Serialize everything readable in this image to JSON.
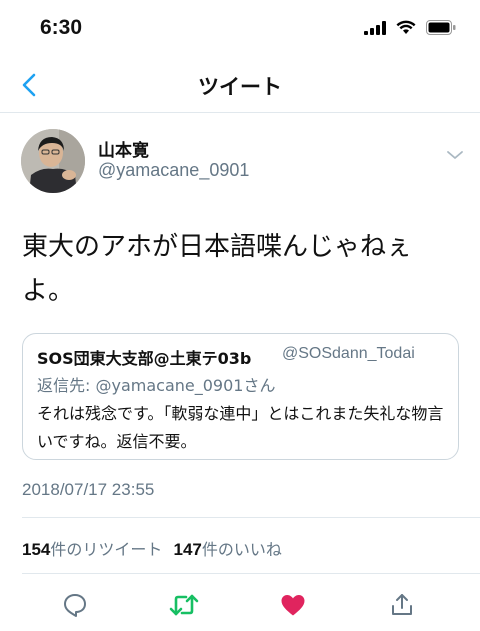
{
  "status_bar": {
    "time": "6:30"
  },
  "nav": {
    "title": "ツイート"
  },
  "tweet": {
    "display_name": "山本寛",
    "handle": "@yamacane_0901",
    "text": "東大のアホが日本語喋んじゃねぇよ。",
    "quote": {
      "display_name": "SOS団東大支部@土東テ03b",
      "handle": "@SOSdann_Todai",
      "reply_to": "返信先: @yamacane_0901さん",
      "text": "それは残念です。「軟弱な連中」とはこれまた失礼な物言いですね。返信不要。"
    },
    "timestamp": "2018/07/17 23:55",
    "stats": {
      "retweet_count": "154",
      "retweet_label": "件のリツイート",
      "like_count": "147",
      "like_label": "件のいいね"
    }
  },
  "actions": {
    "reply_icon": "speech-bubble",
    "retweet_icon": "retweet-arrows",
    "like_icon": "heart",
    "share_icon": "share-arrow"
  },
  "colors": {
    "accent": "#1da1f2",
    "retweet": "#17bf63",
    "like": "#e0245e",
    "secondary_text": "#657786"
  }
}
